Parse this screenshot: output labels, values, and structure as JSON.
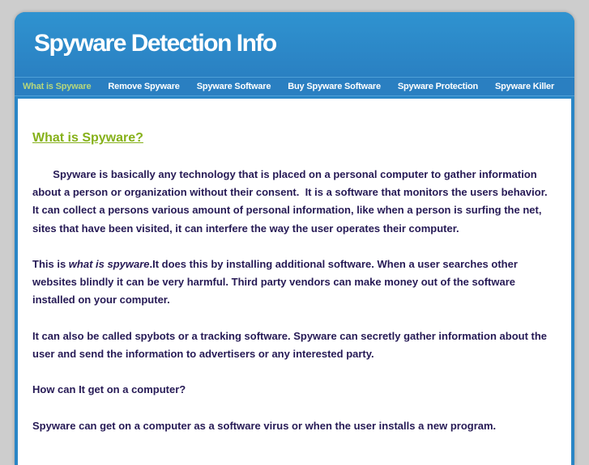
{
  "site": {
    "title": "Spyware Detection Info"
  },
  "nav": {
    "items": [
      {
        "label": "What is Spyware",
        "active": true
      },
      {
        "label": "Remove Spyware"
      },
      {
        "label": "Spyware Software"
      },
      {
        "label": "Buy Spyware Software"
      },
      {
        "label": "Spyware Protection"
      },
      {
        "label": "Spyware Killer"
      }
    ]
  },
  "article": {
    "heading": "What is Spyware?",
    "p1": [
      "       Spyware is basically any technology that is placed on a personal computer to gather information",
      "about a person or organization without their consent.  It is a software that monitors the users behavior.",
      "It can collect a persons various amount of personal information, like when a person is surfing the net,",
      "sites that have been visited, it can interfere the way the user operates their computer."
    ],
    "p2_pre": "This is ",
    "p2_em": "what is spyware",
    "p2_post": ".It does this by installing additional software. When a user searches other",
    "p2": [
      "websites blindly it can be very harmful. Third party vendors can make money out of the software",
      "installed on your computer."
    ],
    "p3": [
      "It can also be called spybots or a tracking software. Spyware can secretly gather information about the",
      "user and send the information to advertisers or any interested party."
    ],
    "p4": "How can It get on a computer?",
    "p5": "Spyware can get on a computer as a software virus or when the user installs a new program."
  },
  "colors": {
    "header": "#2f93d0",
    "heading": "#86b11a",
    "text": "#261a55",
    "nav_active": "#b6d77c"
  }
}
